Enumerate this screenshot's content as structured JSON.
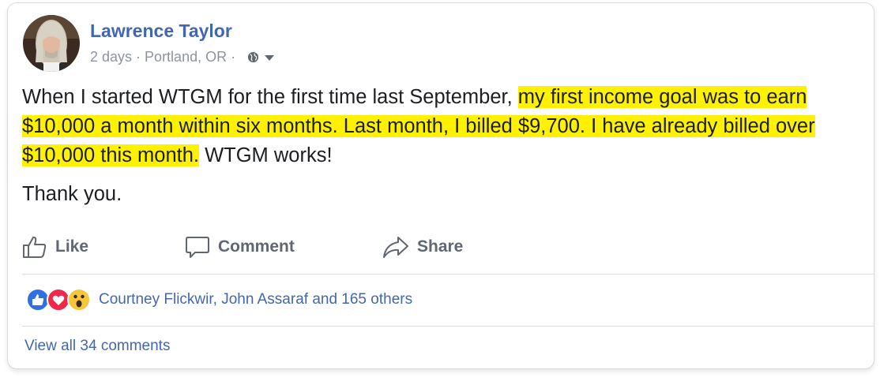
{
  "post": {
    "author": "Lawrence Taylor",
    "time": "2 days",
    "location": "Portland, OR",
    "separator": "·",
    "privacy_icon": "globe-icon",
    "text_plain_before": "When I started WTGM for the first time last September, ",
    "text_highlight": "my first income goal was to earn $10,000 a month within six months. Last month, I billed $9,700. I have already billed over $10,000 this month.",
    "text_plain_after": " WTGM works!",
    "text_thanks": "Thank you."
  },
  "actions": {
    "like": "Like",
    "comment": "Comment",
    "share": "Share"
  },
  "reactions": {
    "icons": [
      "like-reaction-icon",
      "love-reaction-icon",
      "wow-reaction-icon"
    ],
    "summary": "Courtney Flickwir, John Assaraf and 165 others"
  },
  "comments": {
    "view_all": "View all 34 comments"
  },
  "colors": {
    "link_blue": "#4267b2",
    "highlight": "#fff200",
    "muted": "#8d949e",
    "action_gray": "#606770",
    "text": "#1c1e21"
  }
}
